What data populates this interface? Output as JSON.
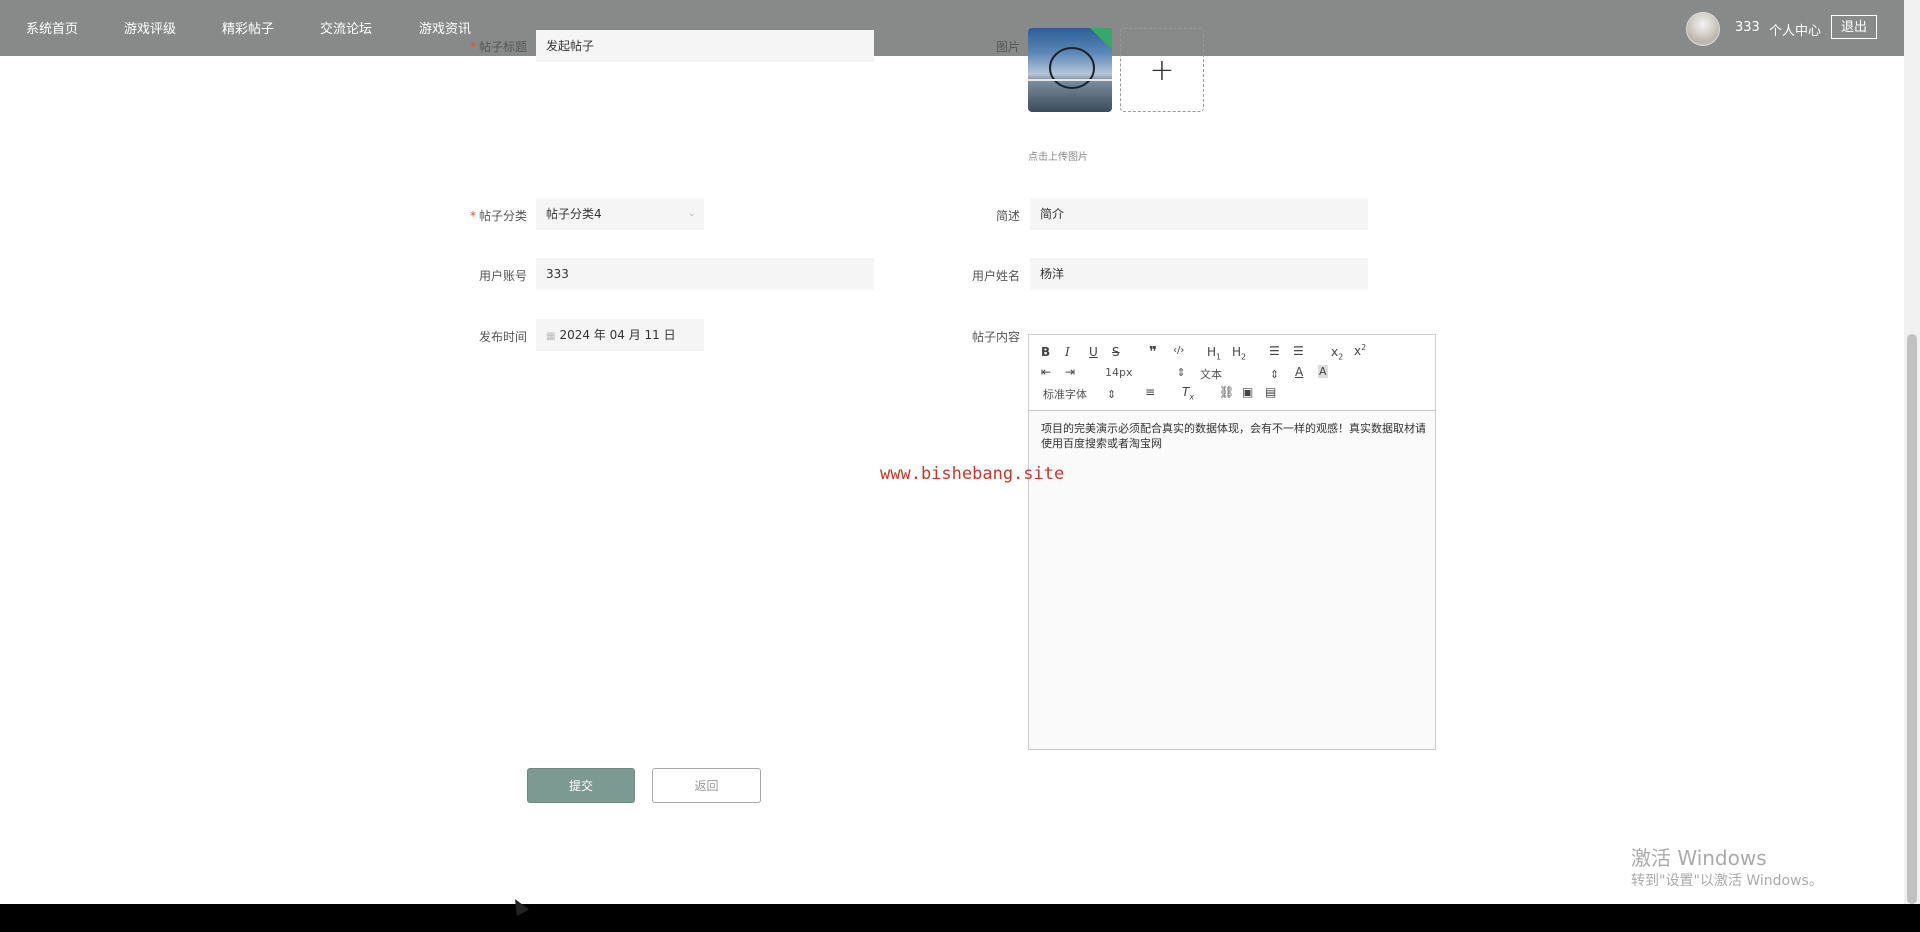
{
  "nav": {
    "items": [
      {
        "label": "系统首页"
      },
      {
        "label": "游戏评级"
      },
      {
        "label": "精彩帖子"
      },
      {
        "label": "交流论坛"
      },
      {
        "label": "游戏资讯"
      }
    ],
    "username": "333",
    "profile_label": "个人中心",
    "logout_label": "退出",
    "bg_color": "#888a89"
  },
  "form": {
    "title_label": "帖子标题",
    "title_value": "发起帖子",
    "image_label": "图片",
    "upload_hint": "点击上传图片",
    "category_label": "帖子分类",
    "category_value": "帖子分类4",
    "summary_label": "简述",
    "summary_value": "简介",
    "account_label": "用户账号",
    "account_value": "333",
    "name_label": "用户姓名",
    "name_value": "杨洋",
    "time_label": "发布时间",
    "time_value": "2024 年 04 月 11 日",
    "content_label": "帖子内容"
  },
  "editor": {
    "font_size": "14px",
    "format": "文本",
    "font_family": "标准字体",
    "content": "项目的完美演示必须配合真实的数据体现，会有不一样的观感！真实数据取材请使用百度搜索或者淘宝网"
  },
  "watermark": "www.bishebang.site",
  "buttons": {
    "submit": "提交",
    "back": "返回",
    "submit_color": "#7d9a92"
  },
  "windows": {
    "activate_title": "激活 Windows",
    "activate_sub": "转到\"设置\"以激活 Windows。"
  }
}
